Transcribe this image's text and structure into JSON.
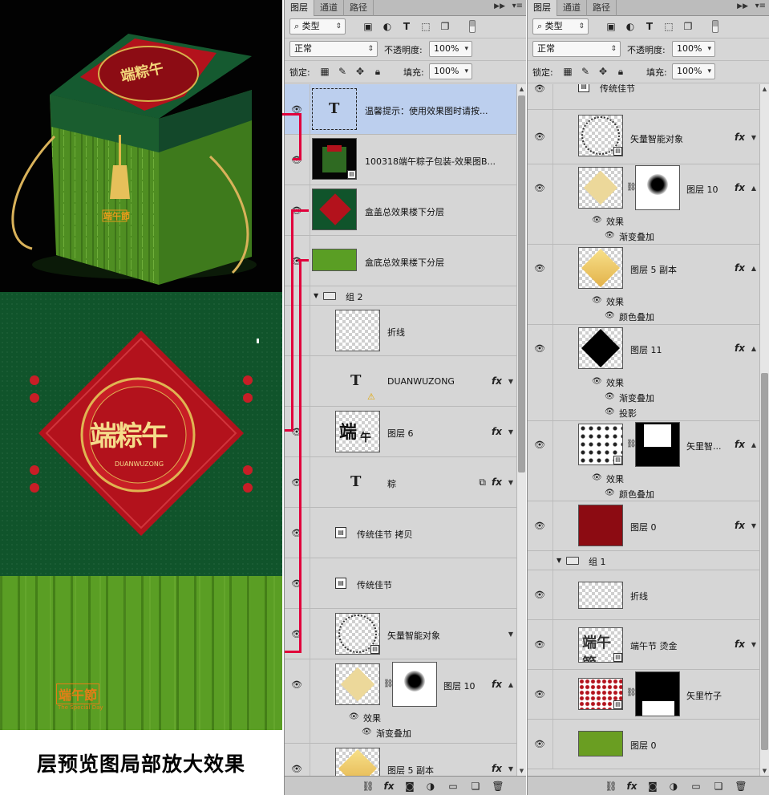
{
  "preview": {
    "caption": "层预览图局部放大效果",
    "lid_title": "端粽午",
    "lid_subtitle": "DUANWUZONG",
    "base_logo": "端午節",
    "base_tagline": "The Special Day"
  },
  "colors": {
    "selected_row": "#bccfee",
    "annotation_red": "#e1003b",
    "box_green": "#10542b",
    "bamboo_green": "#5a9e24",
    "lid_red": "#b3121c"
  },
  "panel_a": {
    "tabs": [
      "图层",
      "通道",
      "路径"
    ],
    "filter_kind": "类型",
    "blend_mode": "正常",
    "opacity_label": "不透明度:",
    "opacity_value": "100%",
    "lock_label": "锁定:",
    "fill_label": "填充:",
    "fill_value": "100%",
    "layers": [
      {
        "name": "温馨提示：使用效果图时请按...",
        "kind": "text",
        "selected": true
      },
      {
        "name": "100318端午粽子包装-效果图B...",
        "kind": "smart"
      },
      {
        "name": "盒盖总效果楼下分层",
        "kind": "image"
      },
      {
        "name": "盒底总效果楼下分层",
        "kind": "image"
      },
      {
        "name": "组 2",
        "kind": "group"
      },
      {
        "name": "折线",
        "kind": "image"
      },
      {
        "name": "DUANWUZONG",
        "kind": "text",
        "fx": "fx"
      },
      {
        "name": "图层 6",
        "kind": "image",
        "fx": "fx"
      },
      {
        "name": "粽",
        "kind": "text",
        "fx": "fx"
      },
      {
        "name": "传统佳节 拷贝",
        "kind": "smart-icon"
      },
      {
        "name": "传统佳节",
        "kind": "smart-icon"
      },
      {
        "name": "矢量智能对象",
        "kind": "smart"
      },
      {
        "name": "图层 10",
        "kind": "masked",
        "fx": "fx",
        "effects_label": "效果",
        "effects": [
          "渐变叠加"
        ]
      },
      {
        "name": "图层 5 副本",
        "kind": "image",
        "fx": "fx"
      }
    ]
  },
  "panel_b": {
    "tabs": [
      "图层",
      "通道",
      "路径"
    ],
    "filter_kind": "类型",
    "blend_mode": "正常",
    "opacity_label": "不透明度:",
    "opacity_value": "100%",
    "lock_label": "锁定:",
    "fill_label": "填充:",
    "fill_value": "100%",
    "layers": [
      {
        "name": "传统佳节",
        "kind": "smart-icon"
      },
      {
        "name": "矢量智能对象",
        "kind": "smart",
        "fx": "fx"
      },
      {
        "name": "图层 10",
        "kind": "masked",
        "fx": "fx",
        "effects_label": "效果",
        "effects": [
          "渐变叠加"
        ]
      },
      {
        "name": "图层 5 副本",
        "kind": "image",
        "fx": "fx",
        "effects_label": "效果",
        "effects": [
          "颜色叠加"
        ]
      },
      {
        "name": "图层 11",
        "kind": "image",
        "fx": "fx",
        "effects_label": "效果",
        "effects": [
          "渐变叠加",
          "投影"
        ]
      },
      {
        "name": "矢里智...",
        "kind": "masked-smart",
        "fx": "fx",
        "effects_label": "效果",
        "effects": [
          "颜色叠加"
        ]
      },
      {
        "name": "图层 0",
        "kind": "image",
        "fx": "fx"
      },
      {
        "name": "组 1",
        "kind": "group"
      },
      {
        "name": "折线",
        "kind": "image"
      },
      {
        "name": "端午节 烫金",
        "kind": "smart",
        "fx": "fx"
      },
      {
        "name": "矢里竹子",
        "kind": "masked-smart"
      },
      {
        "name": "图层 0",
        "kind": "image"
      }
    ]
  }
}
